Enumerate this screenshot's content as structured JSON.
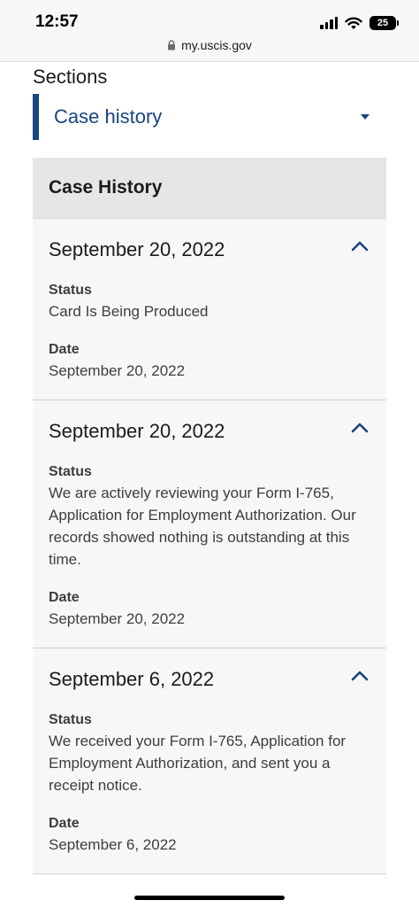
{
  "status_bar": {
    "time": "12:57",
    "battery": "25",
    "url": "my.uscis.gov"
  },
  "sections": {
    "label": "Sections",
    "selected": "Case history"
  },
  "history": {
    "title": "Case History",
    "entries": [
      {
        "heading": "September 20, 2022",
        "status_label": "Status",
        "status": "Card Is Being Produced",
        "date_label": "Date",
        "date": "September 20, 2022"
      },
      {
        "heading": "September 20, 2022",
        "status_label": "Status",
        "status": "We are actively reviewing your Form I-765, Application for Employment Authorization. Our records showed nothing is outstanding at this time.",
        "date_label": "Date",
        "date": "September 20, 2022"
      },
      {
        "heading": "September 6, 2022",
        "status_label": "Status",
        "status": "We received your Form I-765, Application for Employment Authorization, and sent you a receipt notice.",
        "date_label": "Date",
        "date": "September 6, 2022"
      }
    ]
  },
  "colors": {
    "accent": "#1a4480",
    "panel_bg": "#f7f7f7",
    "header_bg": "#e6e6e6"
  },
  "icons": [
    "signal-icon",
    "wifi-icon",
    "battery-icon",
    "lock-icon",
    "caret-down-icon",
    "chevron-up-icon"
  ]
}
